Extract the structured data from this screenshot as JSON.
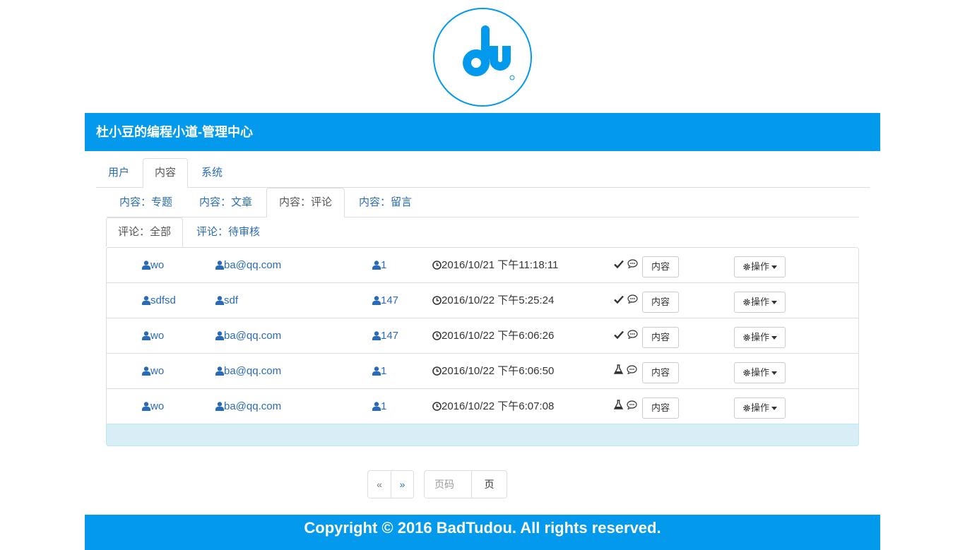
{
  "logo": {
    "text": "du",
    "color": "#0399ec"
  },
  "header": {
    "title": "杜小豆的编程小道-管理中心"
  },
  "main_tabs": [
    {
      "label": "用户",
      "active": false
    },
    {
      "label": "内容",
      "active": true
    },
    {
      "label": "系统",
      "active": false
    }
  ],
  "content_tabs": [
    {
      "label": "内容：专题",
      "active": false
    },
    {
      "label": "内容：文章",
      "active": false
    },
    {
      "label": "内容：评论",
      "active": true
    },
    {
      "label": "内容：留言",
      "active": false
    }
  ],
  "comment_tabs": [
    {
      "label": "评论：全部",
      "active": true
    },
    {
      "label": "评论：待审核",
      "active": false
    }
  ],
  "comments": [
    {
      "name": "wo",
      "email": "ba@qq.com",
      "id": "1",
      "time": "2016/10/21 下午11:18:11",
      "status": "approved",
      "content_label": "内容",
      "op_label": "操作"
    },
    {
      "name": "sdfsd",
      "email": "sdf",
      "id": "147",
      "time": "2016/10/22 下午5:25:24",
      "status": "approved",
      "content_label": "内容",
      "op_label": "操作"
    },
    {
      "name": "wo",
      "email": "ba@qq.com",
      "id": "147",
      "time": "2016/10/22 下午6:06:26",
      "status": "approved",
      "content_label": "内容",
      "op_label": "操作"
    },
    {
      "name": "wo",
      "email": "ba@qq.com",
      "id": "1",
      "time": "2016/10/22 下午6:06:50",
      "status": "pending",
      "content_label": "内容",
      "op_label": "操作"
    },
    {
      "name": "wo",
      "email": "ba@qq.com",
      "id": "1",
      "time": "2016/10/22 下午6:07:08",
      "status": "pending",
      "content_label": "内容",
      "op_label": "操作"
    }
  ],
  "pager": {
    "prev": "«",
    "next": "»",
    "page_placeholder": "页码",
    "go_label": "页"
  },
  "footer": {
    "text": "Copyright © 2016 BadTudou. All rights reserved."
  },
  "colors": {
    "brand": "#0399ec",
    "link": "#2a6bb5",
    "info": "#d9edf7"
  }
}
